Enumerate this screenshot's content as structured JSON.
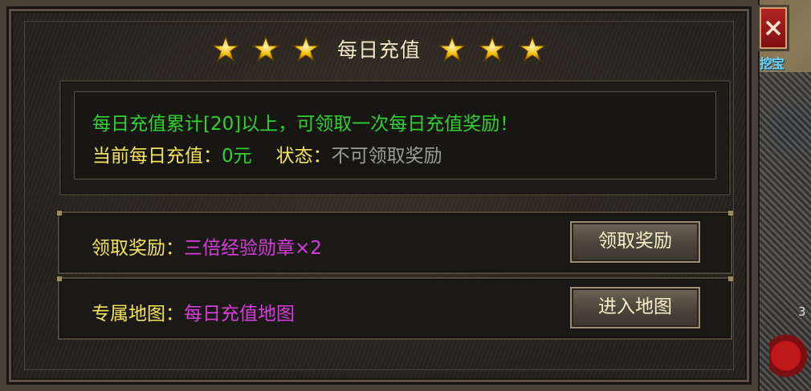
{
  "panel": {
    "title": "每日充值",
    "star_count_each_side": 3
  },
  "info": {
    "line1": "每日充值累计[20]以上，可领取一次每日充值奖励！",
    "recharge_label": "当前每日充值：",
    "recharge_value": "0元",
    "status_label": "状态：",
    "status_value": "不可领取奖励"
  },
  "rows": [
    {
      "label": "领取奖励：",
      "value": "三倍经验勋章×2",
      "button": "领取奖励"
    },
    {
      "label": "专属地图：",
      "value": "每日充值地图",
      "button": "进入地图"
    }
  ],
  "side": {
    "label": "挖宝",
    "number": "3"
  },
  "icons": {
    "close": "close-icon",
    "star": "star-icon"
  },
  "colors": {
    "green_text": "#2fd22f",
    "yellow_text": "#f3e25a",
    "grey_text": "#9b9b9b",
    "magenta_text": "#d83cdc",
    "title_text": "#f2e6c6"
  }
}
